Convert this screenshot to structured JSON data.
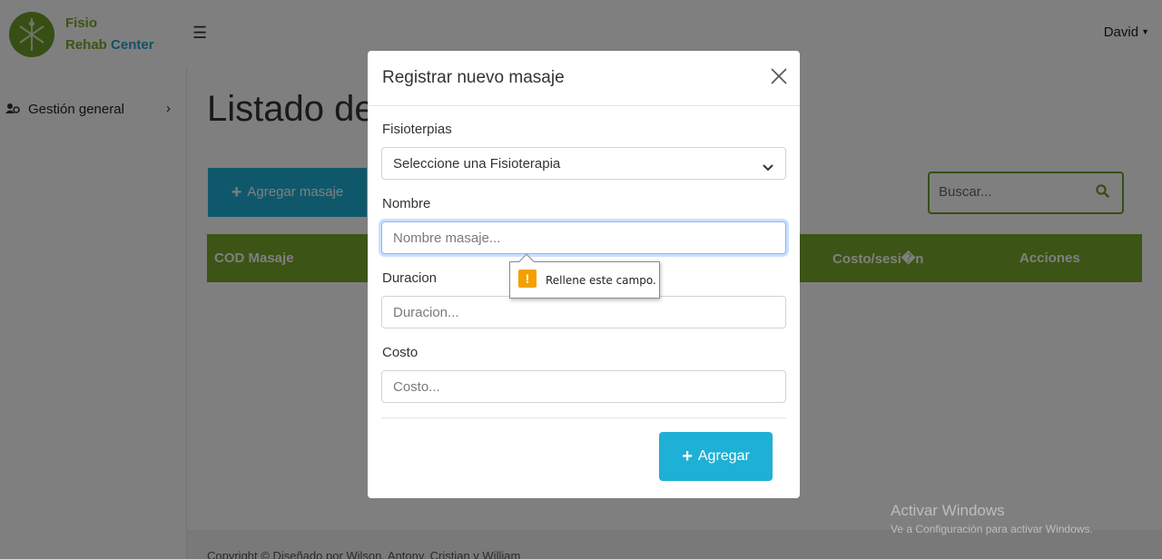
{
  "brand": {
    "line1": "Fisio",
    "line2a": "Rehab",
    "line2b": "Center"
  },
  "header": {
    "menu_icon": "hamburger-icon",
    "user_name": "David"
  },
  "sidebar": {
    "items": [
      {
        "label": "Gestión general",
        "icon": "users-cog-icon"
      }
    ]
  },
  "page": {
    "title": "Listado de",
    "add_button": "Agregar masaje",
    "search_placeholder": "Buscar...",
    "table_headers": [
      "COD Masaje",
      "Costo/sesi�n",
      "Acciones"
    ],
    "footer": "Copyright © Diseñado por Wilson, Antony, Cristian y William"
  },
  "modal": {
    "title": "Registrar nuevo masaje",
    "fields": {
      "fisioterapia": {
        "label": "Fisioterpias",
        "selected": "Seleccione una Fisioterapia"
      },
      "nombre": {
        "label": "Nombre",
        "placeholder": "Nombre masaje..."
      },
      "duracion": {
        "label": "Duracion",
        "placeholder": "Duracion..."
      },
      "costo": {
        "label": "Costo",
        "placeholder": "Costo..."
      }
    },
    "submit_label": "Agregar"
  },
  "validation_tooltip": {
    "icon": "!",
    "text": "Rellene este campo."
  },
  "watermark": {
    "title": "Activar Windows",
    "subtitle": "Ve a Configuración para activar Windows."
  },
  "colors": {
    "brand_green": "#78a82b",
    "accent_blue": "#1fb0d6",
    "logo_green": "#6e9c2a"
  }
}
